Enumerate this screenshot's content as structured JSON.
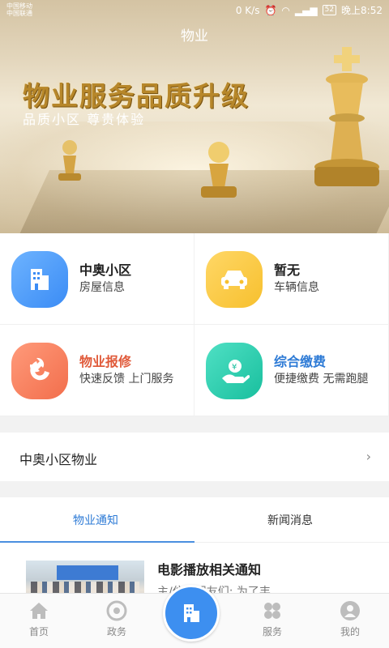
{
  "status_bar": {
    "carrier_1": "中国移动",
    "carrier_2": "中国联通",
    "speed": "0 K/s",
    "battery": "52",
    "time": "晚上8:52"
  },
  "header": {
    "title": "物业"
  },
  "banner": {
    "headline": "物业服务品质升级",
    "subline": "品质小区  尊贵体验"
  },
  "cards": [
    {
      "title": "中奥小区",
      "subtitle": "房屋信息",
      "icon": "building-icon",
      "color": "#3b8cf5",
      "title_color": "#222222"
    },
    {
      "title": "暂无",
      "subtitle": "车辆信息",
      "icon": "car-icon",
      "color": "#f7c02e",
      "title_color": "#222222"
    },
    {
      "title": "物业报修",
      "subtitle": "快速反馈 上门服务",
      "icon": "wrench-icon",
      "color": "#f26e4c",
      "title_color": "#e05a3a"
    },
    {
      "title": "综合缴费",
      "subtitle": "便捷缴费 无需跑腿",
      "icon": "payment-icon",
      "color": "#19bf9e",
      "title_color": "#2e7bd6"
    }
  ],
  "community": {
    "name": "中奥小区物业",
    "chevron": "›"
  },
  "tabs": [
    {
      "label": "物业通知",
      "active": true
    },
    {
      "label": "新闻消息",
      "active": false
    }
  ],
  "news": {
    "title": "电影播放相关通知",
    "snippet": "主/住户朋友们:      为了丰"
  },
  "bottom_nav": [
    {
      "label": "首页",
      "icon": "home-icon"
    },
    {
      "label": "政务",
      "icon": "government-icon"
    },
    {
      "label": "",
      "icon": "building-icon"
    },
    {
      "label": "服务",
      "icon": "grid-icon"
    },
    {
      "label": "我的",
      "icon": "profile-icon"
    }
  ],
  "colors": {
    "accent": "#3d8ff0",
    "active_tab": "#2e7bd6"
  }
}
